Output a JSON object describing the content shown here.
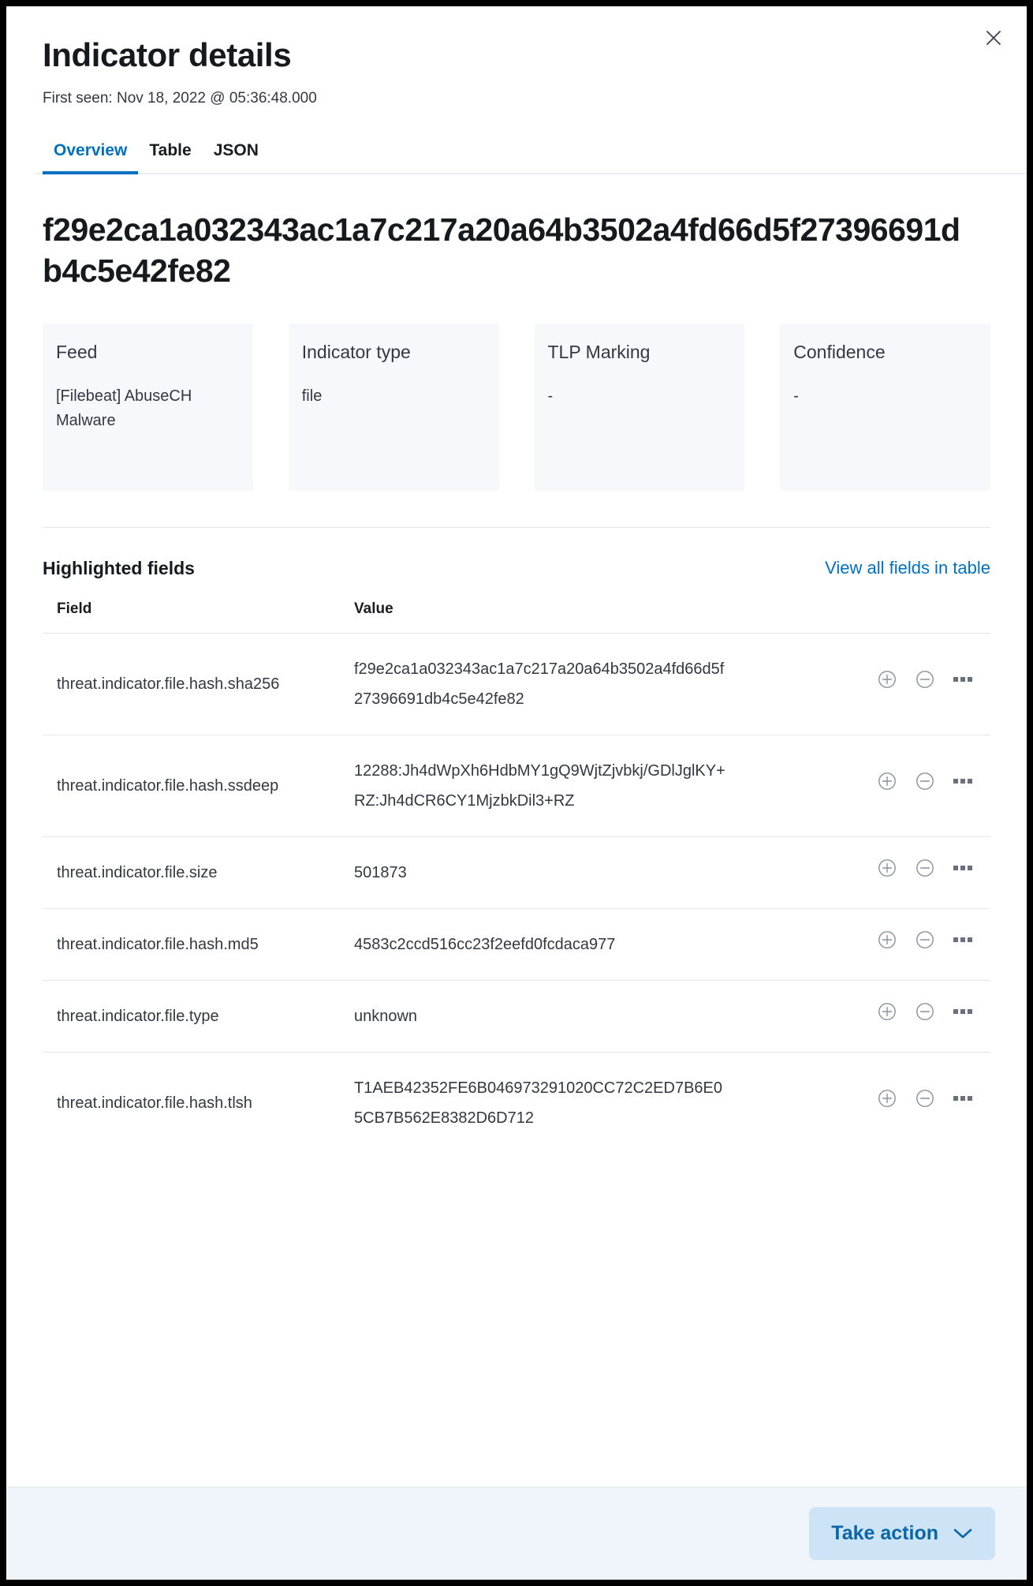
{
  "header": {
    "title": "Indicator details",
    "first_seen": "First seen: Nov 18, 2022 @ 05:36:48.000",
    "close_icon": "close-icon"
  },
  "tabs": [
    {
      "label": "Overview",
      "active": true
    },
    {
      "label": "Table",
      "active": false
    },
    {
      "label": "JSON",
      "active": false
    }
  ],
  "overview": {
    "indicator_hash": "f29e2ca1a032343ac1a7c217a20a64b3502a4fd66d5f27396691db4c5e42fe82",
    "cards": [
      {
        "title": "Feed",
        "value": "[Filebeat] AbuseCH Malware"
      },
      {
        "title": "Indicator type",
        "value": "file"
      },
      {
        "title": "TLP Marking",
        "value": "-"
      },
      {
        "title": "Confidence",
        "value": "-"
      }
    ]
  },
  "highlighted_fields": {
    "title": "Highlighted fields",
    "view_all_link": "View all fields in table",
    "columns": {
      "field": "Field",
      "value": "Value",
      "actions": ""
    },
    "row_actions": [
      {
        "name": "filter-for-value-icon",
        "glyph": "plus-circle"
      },
      {
        "name": "filter-out-value-icon",
        "glyph": "minus-circle"
      },
      {
        "name": "more-actions-icon",
        "glyph": "three-squares"
      }
    ],
    "rows": [
      {
        "field": "threat.indicator.file.hash.sha256",
        "value": "f29e2ca1a032343ac1a7c217a20a64b3502a4fd66d5f27396691db4c5e42fe82"
      },
      {
        "field": "threat.indicator.file.hash.ssdeep",
        "value": "12288:Jh4dWpXh6HdbMY1gQ9WjtZjvbkj/GDlJglKY+RZ:Jh4dCR6CY1MjzbkDil3+RZ"
      },
      {
        "field": "threat.indicator.file.size",
        "value": "501873"
      },
      {
        "field": "threat.indicator.file.hash.md5",
        "value": "4583c2ccd516cc23f2eefd0fcdaca977"
      },
      {
        "field": "threat.indicator.file.type",
        "value": "unknown"
      },
      {
        "field": "threat.indicator.file.hash.tlsh",
        "value": "T1AEB42352FE6B046973291020CC72C2ED7B6E05CB7B562E8382D6D712"
      }
    ]
  },
  "footer": {
    "take_action_label": "Take action",
    "chevron_icon": "chevron-down-icon"
  },
  "colors": {
    "accent": "#0071c2",
    "card_bg": "#f7f8fc",
    "footer_bg": "#f0f4fb",
    "button_bg": "#cce4f5",
    "button_text": "#0b66a8",
    "text": "#343741",
    "heading": "#16191d",
    "border": "#e3e6ed"
  }
}
